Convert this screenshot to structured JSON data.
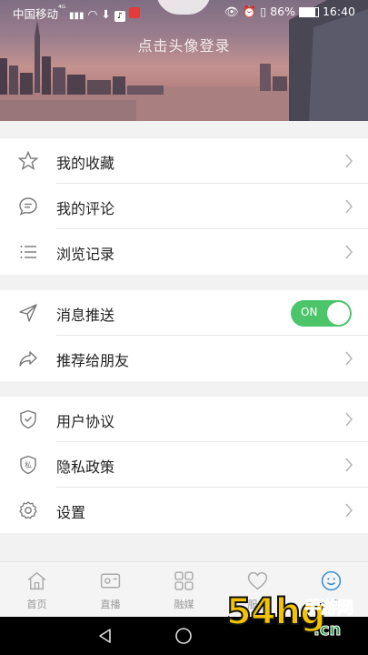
{
  "status_bar": {
    "carrier": "中国移动",
    "network": "⁴ᴳ",
    "battery": "86%",
    "time": "16:40"
  },
  "header": {
    "login_text": "点击头像登录"
  },
  "menu_groups": [
    {
      "items": [
        {
          "label": "我的收藏",
          "icon": "star-icon"
        },
        {
          "label": "我的评论",
          "icon": "comment-icon"
        },
        {
          "label": "浏览记录",
          "icon": "list-icon"
        }
      ]
    },
    {
      "items": [
        {
          "label": "消息推送",
          "icon": "send-icon",
          "toggle": "ON"
        },
        {
          "label": "推荐给朋友",
          "icon": "share-icon"
        }
      ]
    },
    {
      "items": [
        {
          "label": "用户协议",
          "icon": "shield-check-icon"
        },
        {
          "label": "隐私政策",
          "icon": "privacy-shield-icon",
          "icon_text": "私"
        },
        {
          "label": "设置",
          "icon": "gear-icon"
        }
      ]
    }
  ],
  "tabs": [
    {
      "label": "首页",
      "icon": "home-icon"
    },
    {
      "label": "直播",
      "icon": "video-icon"
    },
    {
      "label": "融媒",
      "icon": "grid-icon"
    },
    {
      "label": "服务",
      "icon": "heart-icon"
    },
    {
      "label": "我们",
      "icon": "smile-icon",
      "active": true
    }
  ],
  "watermark": {
    "text": "54hg",
    "sub": "手游网",
    "url": ".cn"
  },
  "colors": {
    "toggle_on": "#4cc46a",
    "tab_active": "#3a8ed3"
  }
}
